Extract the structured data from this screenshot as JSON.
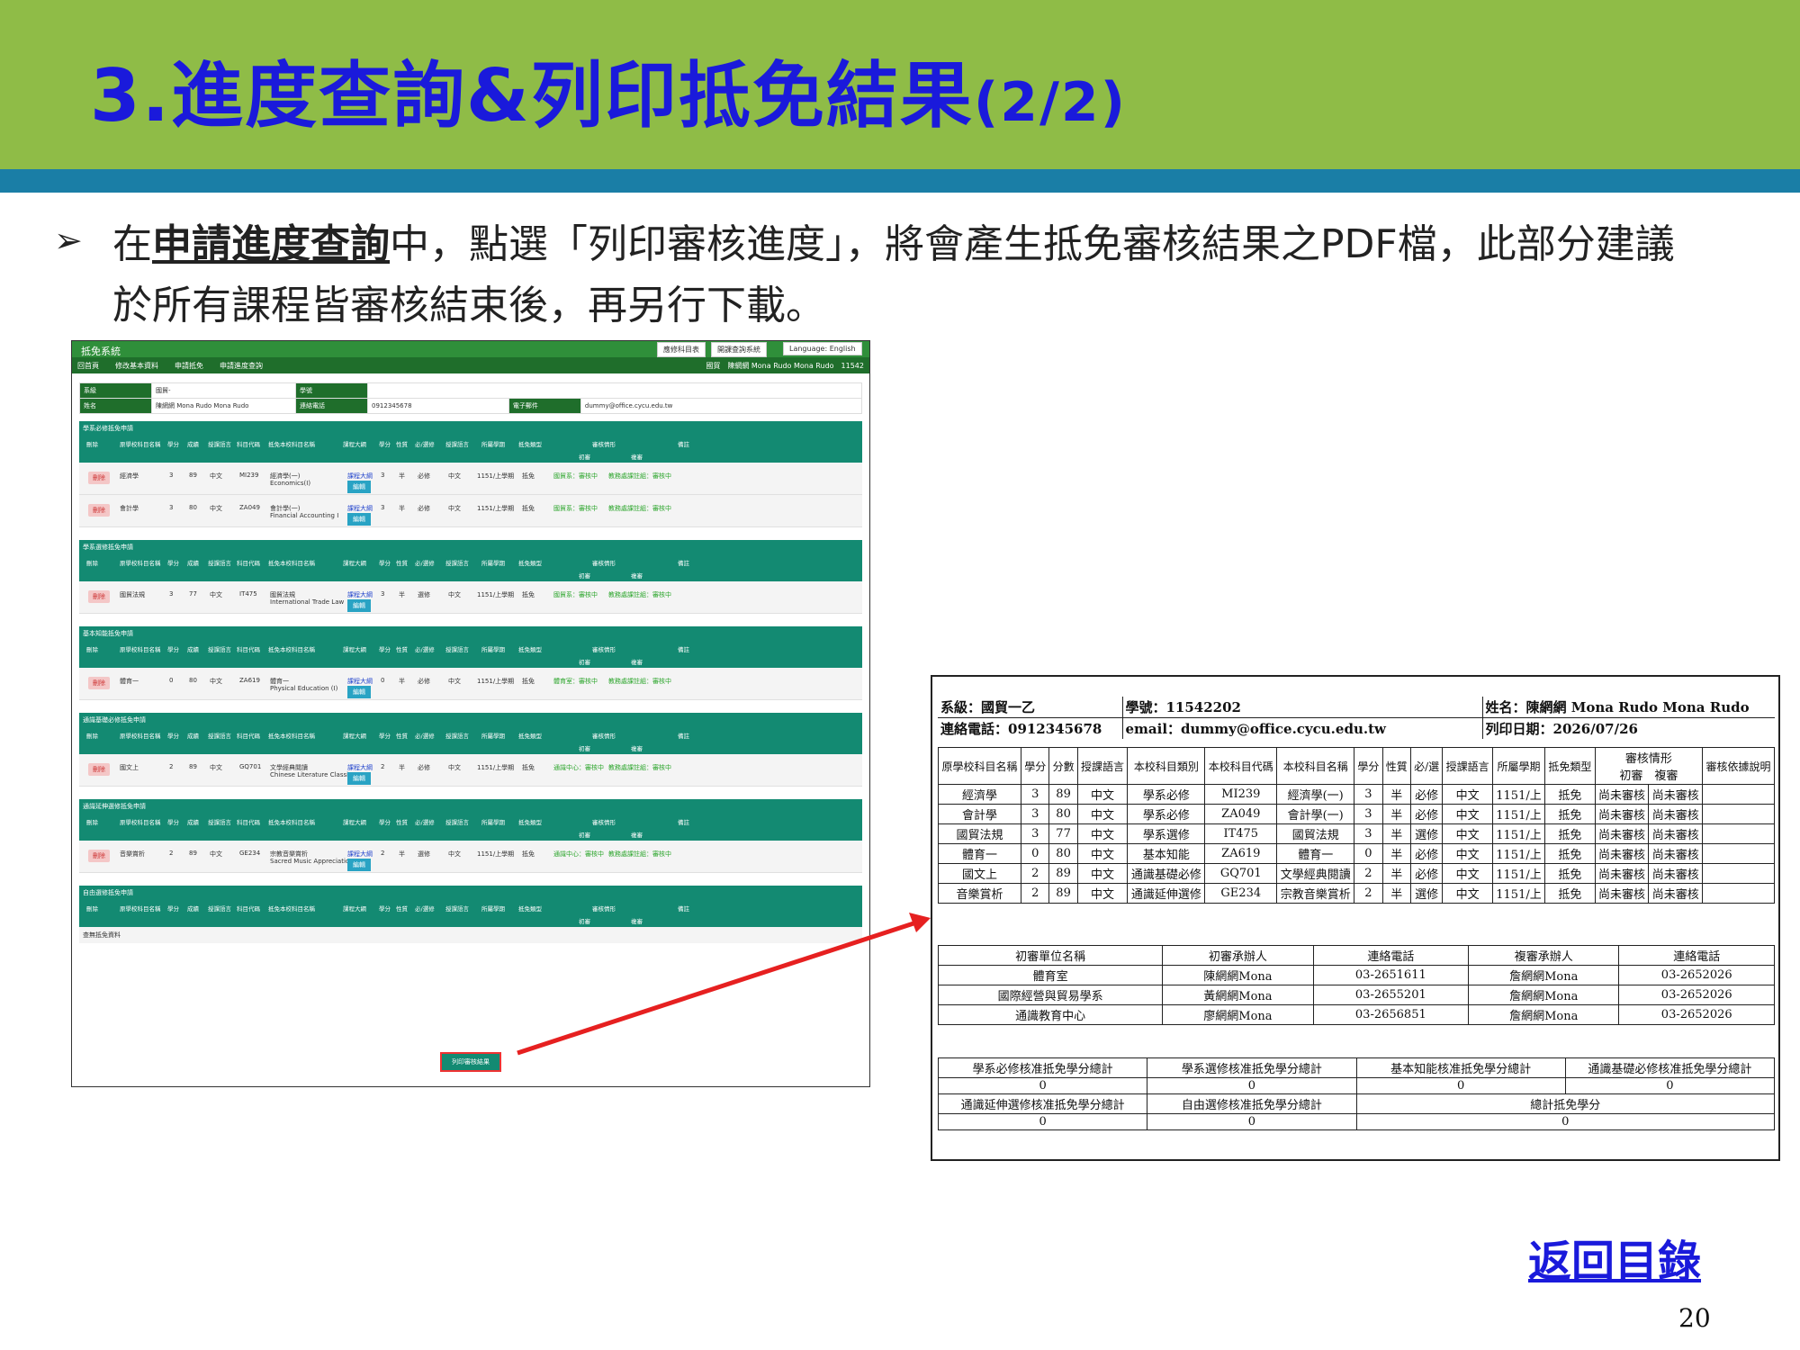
{
  "slide": {
    "title_main": "3.進度查詢&列印抵免結果",
    "title_suffix": "(2/2)",
    "bullet_symbol": "➢",
    "para_prefix": "在",
    "para_bold": "申請進度查詢",
    "para_rest": "中，點選「列印審核進度」，將會產生抵免審核結果之PDF檔，此部分建議於所有課程皆審核結束後，再另行下載。",
    "back_link": "返回目錄",
    "page_number": "20"
  },
  "screenshot": {
    "system_title": "抵免系統",
    "top_buttons": [
      "應修科目表",
      "開課查詢系統",
      "Language: English"
    ],
    "nav": [
      "回首頁",
      "修改基本資料",
      "申請抵免",
      "申請進度查詢"
    ],
    "nav_right": "國貿　陳網網 Mona Rudo Mona Rudo　11542",
    "info": {
      "dept_label": "系級",
      "dept_value": "國貿-",
      "id_label": "學號",
      "id_value": "",
      "name_label": "姓名",
      "name_value": "陳網網 Mona Rudo Mona Rudo",
      "phone_label": "連絡電話",
      "phone_value": "0912345678",
      "email_label": "電子郵件",
      "email_value": "dummy@office.cycu.edu.tw"
    },
    "col_headers": [
      "刪除",
      "原學校科目名稱",
      "學分",
      "成績",
      "授課語言",
      "科目代碼",
      "抵免本校科目名稱",
      "課程大綱",
      "學分",
      "性質",
      "必/選修",
      "授課語言",
      "所屬學期",
      "抵免類型",
      "審核情形",
      "備註"
    ],
    "sub_headers": [
      "初審",
      "複審"
    ],
    "delete_label": "刪除",
    "edit_label": "編輯",
    "syllabus_label": "課程大綱",
    "sections": [
      {
        "title": "學系必修抵免申請",
        "rows": [
          {
            "orig": "經濟學",
            "credit": "3",
            "score": "89",
            "lang": "中文",
            "code": "MI239",
            "target": "經濟學(一)",
            "target_en": "Economics(I)",
            "c2": "3",
            "nature": "半",
            "req": "必修",
            "lang2": "中文",
            "term": "1151/上學期",
            "type": "抵免",
            "r1": "國貿系：審核中",
            "r2": "教務處課註組：審核中"
          },
          {
            "orig": "會計學",
            "credit": "3",
            "score": "80",
            "lang": "中文",
            "code": "ZA049",
            "target": "會計學(一)",
            "target_en": "Financial Accounting I",
            "c2": "3",
            "nature": "半",
            "req": "必修",
            "lang2": "中文",
            "term": "1151/上學期",
            "type": "抵免",
            "r1": "國貿系：審核中",
            "r2": "教務處課註組：審核中"
          }
        ]
      },
      {
        "title": "學系選修抵免申請",
        "rows": [
          {
            "orig": "國貿法規",
            "credit": "3",
            "score": "77",
            "lang": "中文",
            "code": "IT475",
            "target": "國貿法規",
            "target_en": "International Trade Law",
            "c2": "3",
            "nature": "半",
            "req": "選修",
            "lang2": "中文",
            "term": "1151/上學期",
            "type": "抵免",
            "r1": "國貿系：審核中",
            "r2": "教務處課註組：審核中"
          }
        ]
      },
      {
        "title": "基本知能抵免申請",
        "rows": [
          {
            "orig": "體育一",
            "credit": "0",
            "score": "80",
            "lang": "中文",
            "code": "ZA619",
            "target": "體育一",
            "target_en": "Physical Education (I)",
            "c2": "0",
            "nature": "半",
            "req": "必修",
            "lang2": "中文",
            "term": "1151/上學期",
            "type": "抵免",
            "r1": "體育室：審核中",
            "r2": "教務處課註組：審核中"
          }
        ]
      },
      {
        "title": "通識基礎必修抵免申請",
        "rows": [
          {
            "orig": "國文上",
            "credit": "2",
            "score": "89",
            "lang": "中文",
            "code": "GQ701",
            "target": "文學經典閱讀",
            "target_en": "Chinese Literature Classics",
            "c2": "2",
            "nature": "半",
            "req": "必修",
            "lang2": "中文",
            "term": "1151/上學期",
            "type": "抵免",
            "r1": "通識中心：審核中",
            "r2": "教務處課註組：審核中"
          }
        ]
      },
      {
        "title": "通識延伸選修抵免申請",
        "rows": [
          {
            "orig": "音樂賞析",
            "credit": "2",
            "score": "89",
            "lang": "中文",
            "code": "GE234",
            "target": "宗教音樂賞析",
            "target_en": "Sacred Music Appreciation",
            "c2": "2",
            "nature": "半",
            "req": "選修",
            "lang2": "中文",
            "term": "1151/上學期",
            "type": "抵免",
            "r1": "通識中心：審核中",
            "r2": "教務處課註組：審核中"
          }
        ]
      },
      {
        "title": "自由選修抵免申請",
        "rows": [],
        "empty": "查無抵免資料"
      }
    ],
    "print_button": "列印審核結果"
  },
  "pdf": {
    "dept": "系級：國貿一乙",
    "student_id": "學號：11542202",
    "name": "姓名：陳網網 Mona Rudo Mona Rudo",
    "phone": "連絡電話：0912345678",
    "email": "email：dummy@office.cycu.edu.tw",
    "print_date": "列印日期：2026/07/26",
    "headers": [
      "原學校科目名稱",
      "學分",
      "分數",
      "授課語言",
      "本校科目類別",
      "本校科目代碼",
      "本校科目名稱",
      "學分",
      "性質",
      "必/選",
      "授課語言",
      "所屬學期",
      "抵免類型",
      "審核情形",
      "審核依據說明"
    ],
    "review_sub": [
      "初審",
      "複審"
    ],
    "rows": [
      [
        "經濟學",
        "3",
        "89",
        "中文",
        "學系必修",
        "MI239",
        "經濟學(一)",
        "3",
        "半",
        "必修",
        "中文",
        "1151/上",
        "抵免",
        "尚未審核",
        "尚未審核",
        ""
      ],
      [
        "會計學",
        "3",
        "80",
        "中文",
        "學系必修",
        "ZA049",
        "會計學(一)",
        "3",
        "半",
        "必修",
        "中文",
        "1151/上",
        "抵免",
        "尚未審核",
        "尚未審核",
        ""
      ],
      [
        "國貿法規",
        "3",
        "77",
        "中文",
        "學系選修",
        "IT475",
        "國貿法規",
        "3",
        "半",
        "選修",
        "中文",
        "1151/上",
        "抵免",
        "尚未審核",
        "尚未審核",
        ""
      ],
      [
        "體育一",
        "0",
        "80",
        "中文",
        "基本知能",
        "ZA619",
        "體育一",
        "0",
        "半",
        "必修",
        "中文",
        "1151/上",
        "抵免",
        "尚未審核",
        "尚未審核",
        ""
      ],
      [
        "國文上",
        "2",
        "89",
        "中文",
        "通識基礎必修",
        "GQ701",
        "文學經典閱讀",
        "2",
        "半",
        "必修",
        "中文",
        "1151/上",
        "抵免",
        "尚未審核",
        "尚未審核",
        ""
      ],
      [
        "音樂賞析",
        "2",
        "89",
        "中文",
        "通識延伸選修",
        "GE234",
        "宗教音樂賞析",
        "2",
        "半",
        "選修",
        "中文",
        "1151/上",
        "抵免",
        "尚未審核",
        "尚未審核",
        ""
      ]
    ],
    "contact_headers": [
      "初審單位名稱",
      "初審承辦人",
      "連絡電話",
      "複審承辦人",
      "連絡電話"
    ],
    "contacts": [
      [
        "體育室",
        "陳網網Mona",
        "03-2651611",
        "詹網網Mona",
        "03-2652026"
      ],
      [
        "國際經營與貿易學系",
        "黃網網Mona",
        "03-2655201",
        "詹網網Mona",
        "03-2652026"
      ],
      [
        "通識教育中心",
        "廖網網Mona",
        "03-2656851",
        "詹網網Mona",
        "03-2652026"
      ]
    ],
    "totals_row1_labels": [
      "學系必修核准抵免學分總計",
      "學系選修核准抵免學分總計",
      "基本知能核准抵免學分總計",
      "通識基礎必修核准抵免學分總計"
    ],
    "totals_row1_values": [
      "0",
      "0",
      "0",
      "0"
    ],
    "totals_row2_labels": [
      "通識延伸選修核准抵免學分總計",
      "自由選修核准抵免學分總計",
      "總計抵免學分"
    ],
    "totals_row2_values": [
      "0",
      "0",
      "0"
    ]
  },
  "colors": {
    "header_green": "#8fbc47",
    "stripe_blue": "#1a7ea6",
    "title_blue": "#1a1adb",
    "arrow_red": "#e62020"
  }
}
